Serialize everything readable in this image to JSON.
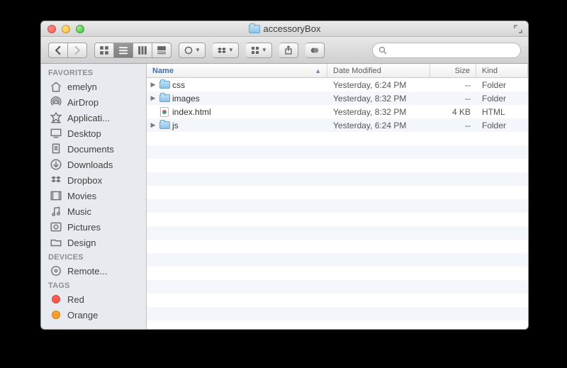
{
  "window": {
    "title": "accessoryBox"
  },
  "search": {
    "placeholder": ""
  },
  "columns": {
    "name": "Name",
    "date": "Date Modified",
    "size": "Size",
    "kind": "Kind"
  },
  "sidebar": {
    "favorites_header": "FAVORITES",
    "favorites": [
      {
        "label": "emelyn",
        "icon": "home"
      },
      {
        "label": "AirDrop",
        "icon": "airdrop"
      },
      {
        "label": "Applicati...",
        "icon": "apps"
      },
      {
        "label": "Desktop",
        "icon": "desktop"
      },
      {
        "label": "Documents",
        "icon": "documents"
      },
      {
        "label": "Downloads",
        "icon": "downloads"
      },
      {
        "label": "Dropbox",
        "icon": "dropbox"
      },
      {
        "label": "Movies",
        "icon": "movies"
      },
      {
        "label": "Music",
        "icon": "music"
      },
      {
        "label": "Pictures",
        "icon": "pictures"
      },
      {
        "label": "Design",
        "icon": "folder"
      }
    ],
    "devices_header": "DEVICES",
    "devices": [
      {
        "label": "Remote...",
        "icon": "disc"
      }
    ],
    "tags_header": "TAGS",
    "tags": [
      {
        "label": "Red",
        "color": "#ff5a52"
      },
      {
        "label": "Orange",
        "color": "#ff9e2c"
      }
    ]
  },
  "rows": [
    {
      "name": "css",
      "expandable": true,
      "type": "folder",
      "date": "Yesterday, 6:24 PM",
      "size": "--",
      "kind": "Folder"
    },
    {
      "name": "images",
      "expandable": true,
      "type": "folder",
      "date": "Yesterday, 8:32 PM",
      "size": "--",
      "kind": "Folder"
    },
    {
      "name": "index.html",
      "expandable": false,
      "type": "html",
      "date": "Yesterday, 8:32 PM",
      "size": "4 KB",
      "kind": "HTML"
    },
    {
      "name": "js",
      "expandable": true,
      "type": "folder",
      "date": "Yesterday, 6:24 PM",
      "size": "--",
      "kind": "Folder"
    }
  ]
}
